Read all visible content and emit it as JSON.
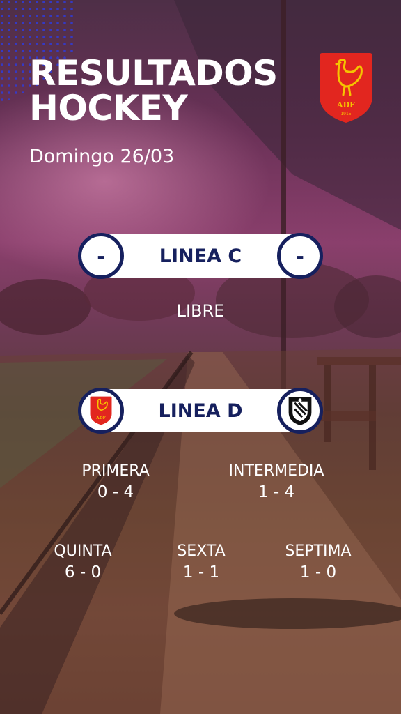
{
  "header": {
    "title_line1": "RESULTADOS",
    "title_line2": "HOCKEY",
    "date": "Domingo 26/03"
  },
  "club_logo": {
    "text": "ADF",
    "year": "1915"
  },
  "linea_c": {
    "label": "LINEA C",
    "left_score": "-",
    "right_score": "-",
    "status": "LIBRE"
  },
  "linea_d": {
    "label": "LINEA D",
    "results": [
      {
        "category": "PRIMERA",
        "score": "0 - 4"
      },
      {
        "category": "INTERMEDIA",
        "score": "1 - 4"
      },
      {
        "category": "QUINTA",
        "score": "6 - 0"
      },
      {
        "category": "SEXTA",
        "score": "1 - 1"
      },
      {
        "category": "SEPTIMA",
        "score": "1 - 0"
      }
    ]
  },
  "colors": {
    "navy": "#16205e",
    "club_red": "#e2261f",
    "rooster_yellow": "#f5c400",
    "magenta_overlay": "#8a3f6c"
  }
}
